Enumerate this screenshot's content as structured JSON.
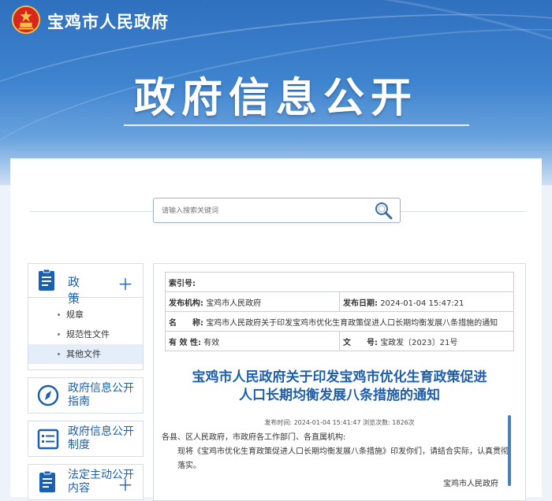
{
  "header": {
    "site_name": "宝鸡市人民政府",
    "banner_title": "政府信息公开"
  },
  "search": {
    "placeholder": "请输入搜索关键词"
  },
  "sidebar": {
    "section_title": "政 策",
    "items": [
      {
        "label": "规章",
        "active": false
      },
      {
        "label": "规范性文件",
        "active": false
      },
      {
        "label": "其他文件",
        "active": true
      }
    ],
    "cards": [
      {
        "label": "政府信息公开指南",
        "has_plus": false,
        "icon": "compass-icon"
      },
      {
        "label": "政府信息公开制度",
        "has_plus": false,
        "icon": "list-icon"
      },
      {
        "label": "法定主动公开内容",
        "has_plus": true,
        "icon": "document-icon"
      }
    ]
  },
  "meta": {
    "index_label": "索引号:",
    "index_value": "",
    "publisher_label": "发布机构:",
    "publisher_value": "宝鸡市人民政府",
    "date_label": "发布日期:",
    "date_value": "2024-01-04 15:47:21",
    "name_label": "名　　称:",
    "name_value": "宝鸡市人民政府关于印发宝鸡市优化生育政策促进人口长期均衡发展八条措施的通知",
    "validity_label": "有 效 性:",
    "validity_value": "有效",
    "docno_label": "文　　号:",
    "docno_value": "宝政发〔2023〕21号"
  },
  "article": {
    "title_line1": "宝鸡市人民政府关于印发宝鸡市优化生育政策促进",
    "title_line2": "人口长期均衡发展八条措施的通知",
    "pubinfo": "发布时间: 2024-01-04 15:41:47 浏览次数: 1826次",
    "salutation": "各县、区人民政府，市政府各工作部门、各直属机构:",
    "para1": "现将《宝鸡市优化生育政策促进人口长期均衡发展八条措施》印发你们，请结合实际，认真贯彻落实。",
    "signature": "宝鸡市人民政府"
  },
  "colors": {
    "brand_blue": "#1b5fae",
    "title_blue": "#1f5ea8",
    "banner_blue": "#3f84cf"
  }
}
